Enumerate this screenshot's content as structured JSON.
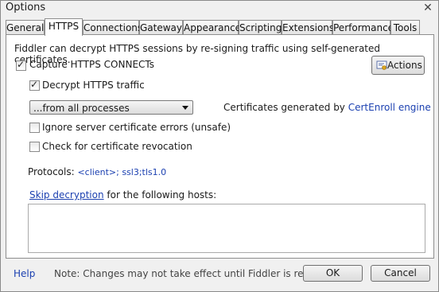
{
  "window": {
    "title": "Options",
    "close_glyph": "✕"
  },
  "tabs": [
    {
      "label": "General"
    },
    {
      "label": "HTTPS",
      "active": true
    },
    {
      "label": "Connections"
    },
    {
      "label": "Gateway"
    },
    {
      "label": "Appearance"
    },
    {
      "label": "Scripting"
    },
    {
      "label": "Extensions"
    },
    {
      "label": "Performance"
    },
    {
      "label": "Tools"
    }
  ],
  "https": {
    "intro": "Fiddler can decrypt HTTPS sessions by re-signing traffic using self-generated certificates.",
    "capture_label": "Capture HTTPS CONNECTs",
    "capture_checked": true,
    "decrypt_label": "Decrypt HTTPS traffic",
    "decrypt_checked": true,
    "process_filter": "...from all processes",
    "cert_prefix": "Certificates generated by ",
    "cert_engine": "CertEnroll engine",
    "ignore_errors_label": "Ignore server certificate errors (unsafe)",
    "ignore_errors_checked": false,
    "revocation_label": "Check for certificate revocation",
    "revocation_checked": false,
    "protocols_label": "Protocols: ",
    "protocols_value": "<client>; ssl3;tls1.0",
    "skip_link": "Skip decryption",
    "skip_suffix": " for the following hosts:",
    "hosts_value": "",
    "actions_label": "Actions",
    "actions_icon": "certificate-icon"
  },
  "footer": {
    "help_label": "Help",
    "note": "Note: Changes may not take effect until Fiddler is restarted.",
    "ok_label": "OK",
    "cancel_label": "Cancel"
  },
  "colors": {
    "link": "#1a3fb0",
    "background": "#f0f0f0"
  }
}
